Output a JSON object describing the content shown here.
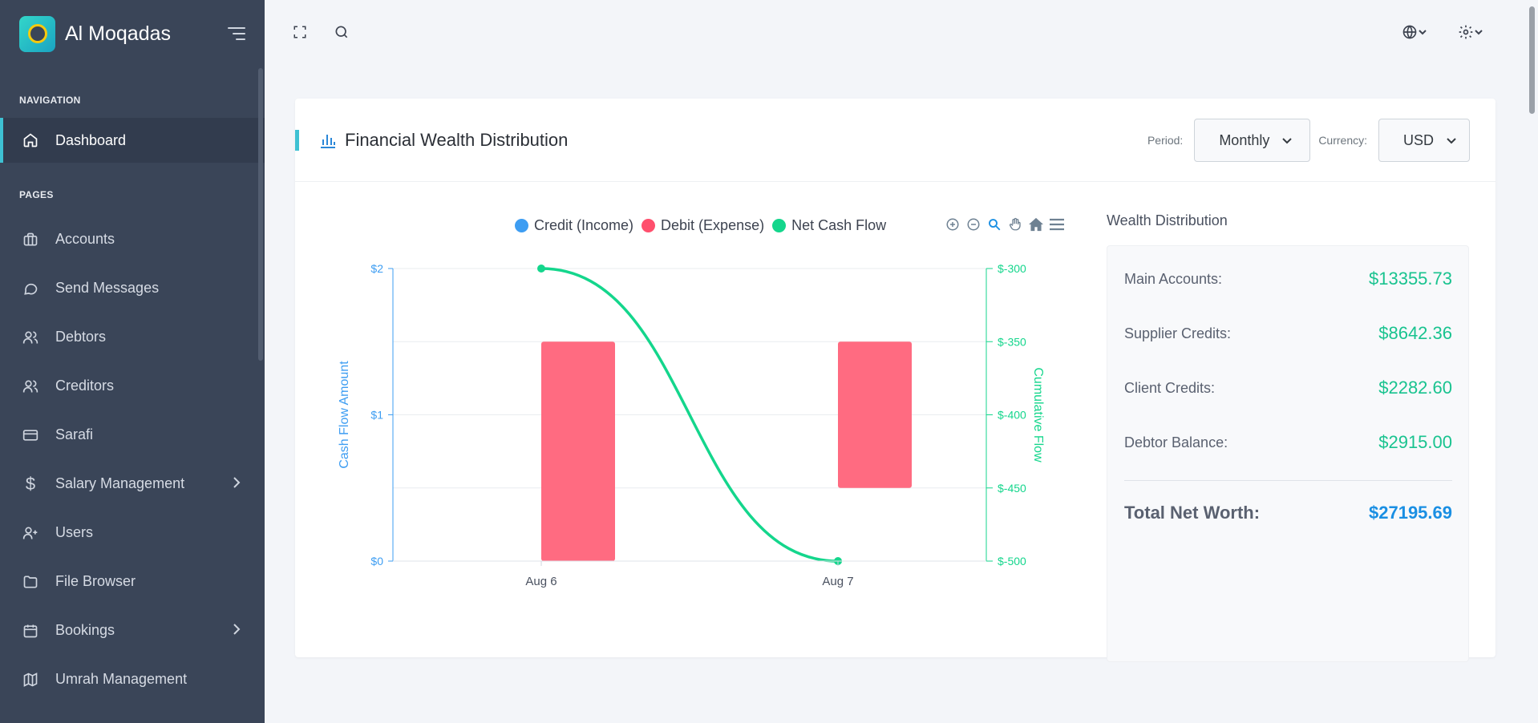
{
  "app": {
    "brand": "Al Moqadas"
  },
  "sidebar": {
    "sections": [
      {
        "title": "NAVIGATION"
      },
      {
        "title": "PAGES"
      }
    ],
    "items": [
      {
        "label": "Dashboard",
        "icon": "home-icon",
        "active": true
      },
      {
        "label": "Accounts",
        "icon": "briefcase-icon"
      },
      {
        "label": "Send Messages",
        "icon": "message-icon"
      },
      {
        "label": "Debtors",
        "icon": "users-icon"
      },
      {
        "label": "Creditors",
        "icon": "users-icon"
      },
      {
        "label": "Sarafi",
        "icon": "credit-card-icon"
      },
      {
        "label": "Salary Management",
        "icon": "dollar-icon",
        "has_submenu": true
      },
      {
        "label": "Users",
        "icon": "user-plus-icon"
      },
      {
        "label": "File Browser",
        "icon": "folder-icon"
      },
      {
        "label": "Bookings",
        "icon": "calendar-icon",
        "has_submenu": true
      },
      {
        "label": "Umrah Management",
        "icon": "map-icon"
      }
    ]
  },
  "card": {
    "title": "Financial Wealth Distribution",
    "period_label": "Period:",
    "period_value": "Monthly",
    "currency_label": "Currency:",
    "currency_value": "USD"
  },
  "chart_data": {
    "type": "bar",
    "categories": [
      "Aug 6",
      "Aug 7"
    ],
    "series": [
      {
        "name": "Credit (Income)",
        "type": "bar",
        "axis": "left",
        "color": "#3d9df2",
        "values": [
          0,
          0
        ]
      },
      {
        "name": "Debit (Expense)",
        "type": "bar",
        "axis": "left",
        "color": "#ff6b81",
        "range": [
          [
            0,
            1.5
          ],
          [
            0.5,
            1.5
          ]
        ]
      },
      {
        "name": "Net Cash Flow",
        "type": "line",
        "axis": "right",
        "color": "#14d68c",
        "values": [
          -300,
          -500
        ]
      }
    ],
    "ylabel": "Cash Flow Amount",
    "y2label": "Cumulative Flow",
    "ylim": [
      0,
      2
    ],
    "y2lim": [
      -500,
      -300
    ],
    "yticks": [
      "$0",
      "$1",
      "$2"
    ],
    "y2ticks": [
      "$-500",
      "$-450",
      "$-400",
      "$-350",
      "$-300"
    ],
    "legend_position": "top"
  },
  "wealth": {
    "title": "Wealth Distribution",
    "rows": [
      {
        "label": "Main Accounts:",
        "value": "$13355.73"
      },
      {
        "label": "Supplier Credits:",
        "value": "$8642.36"
      },
      {
        "label": "Client Credits:",
        "value": "$2282.60"
      },
      {
        "label": "Debtor Balance:",
        "value": "$2915.00"
      }
    ],
    "total_label": "Total Net Worth:",
    "total_value": "$27195.69"
  },
  "colors": {
    "sidebar": "#3a4558",
    "accent": "#3ec1d3",
    "positive": "#19c38f",
    "total": "#1a8fe3"
  }
}
